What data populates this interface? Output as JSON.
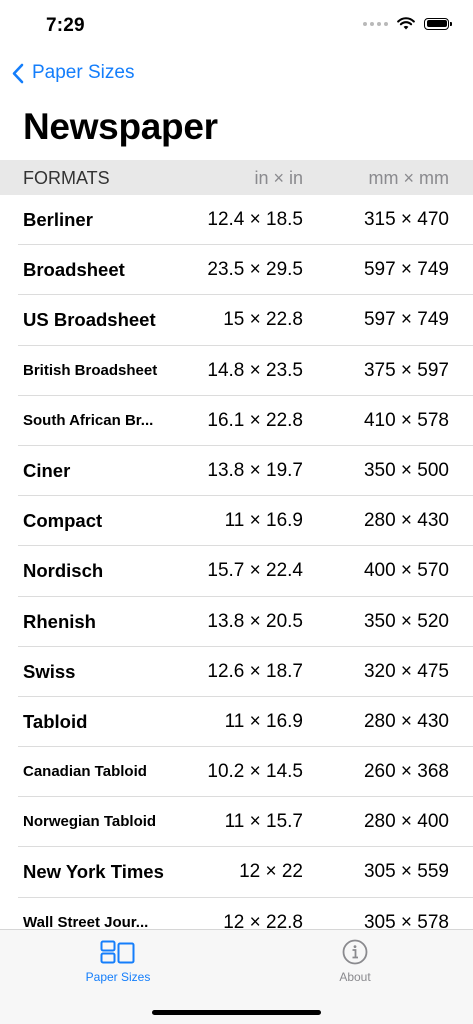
{
  "status": {
    "time": "7:29"
  },
  "nav": {
    "back_label": "Paper Sizes"
  },
  "page": {
    "title": "Newspaper"
  },
  "table": {
    "header": {
      "name": "FORMATS",
      "in": "in × in",
      "mm": "mm × mm"
    },
    "rows": [
      {
        "name": "Berliner",
        "in": "12.4 × 18.5",
        "mm": "315 × 470"
      },
      {
        "name": "Broadsheet",
        "in": "23.5 × 29.5",
        "mm": "597 × 749"
      },
      {
        "name": "US Broadsheet",
        "in": "15 × 22.8",
        "mm": "597 × 749"
      },
      {
        "name": "British Broadsheet",
        "in": "14.8 × 23.5",
        "mm": "375 × 597"
      },
      {
        "name": "South African Br...",
        "in": "16.1 × 22.8",
        "mm": "410 × 578"
      },
      {
        "name": "Ciner",
        "in": "13.8 × 19.7",
        "mm": "350 × 500"
      },
      {
        "name": "Compact",
        "in": "11 × 16.9",
        "mm": "280 × 430"
      },
      {
        "name": "Nordisch",
        "in": "15.7 × 22.4",
        "mm": "400 × 570"
      },
      {
        "name": "Rhenish",
        "in": "13.8 × 20.5",
        "mm": "350 × 520"
      },
      {
        "name": "Swiss",
        "in": "12.6 × 18.7",
        "mm": "320 × 475"
      },
      {
        "name": "Tabloid",
        "in": "11 × 16.9",
        "mm": "280 × 430"
      },
      {
        "name": "Canadian Tabloid",
        "in": "10.2 × 14.5",
        "mm": "260 × 368"
      },
      {
        "name": "Norwegian Tabloid",
        "in": "11 × 15.7",
        "mm": "280 × 400"
      },
      {
        "name": "New York Times",
        "in": "12 × 22",
        "mm": "305 × 559"
      },
      {
        "name": "Wall Street Jour...",
        "in": "12 × 22.8",
        "mm": "305 × 578"
      }
    ]
  },
  "tabs": [
    {
      "label": "Paper Sizes",
      "icon": "paper-sizes-icon",
      "selected": true
    },
    {
      "label": "About",
      "icon": "info-icon",
      "selected": false
    }
  ],
  "colors": {
    "accent": "#147efb",
    "inactive": "#8a8a8e",
    "header_bg": "#e8e8e8"
  }
}
